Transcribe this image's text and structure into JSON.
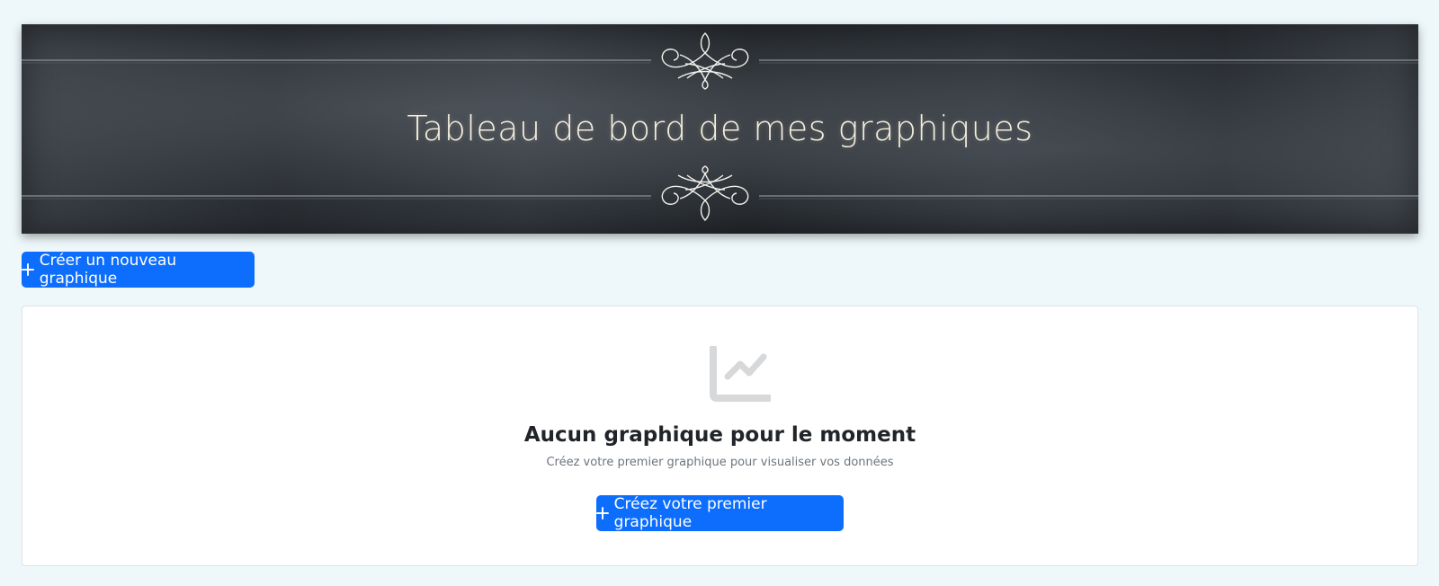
{
  "header": {
    "title": "Tableau de bord de mes graphiques"
  },
  "toolbar": {
    "create_button_label": "Créer un nouveau graphique"
  },
  "empty_state": {
    "icon": "chart-line-icon",
    "title": "Aucun graphique pour le moment",
    "subtitle": "Créez votre premier graphique pour visualiser vos données",
    "button_label": "Créez votre premier graphique"
  },
  "colors": {
    "page_background": "#eef8fa",
    "primary": "#0d6efd",
    "banner_text": "#f4eedf",
    "empty_icon": "#d6d8da"
  }
}
